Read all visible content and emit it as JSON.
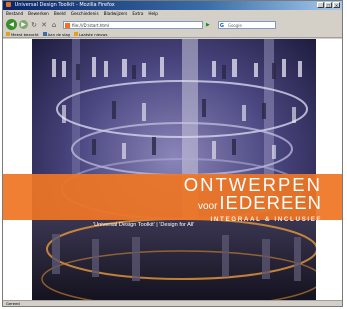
{
  "window": {
    "title": "Universal Design Toolkit - Mozilla Firefox"
  },
  "menu": [
    "Bestand",
    "Bewerken",
    "Beeld",
    "Geschiedenis",
    "Bladwijzers",
    "Extra",
    "Help"
  ],
  "nav": {
    "url": "file:///D:/start.html",
    "search_placeholder": "Google"
  },
  "bookmarks": [
    "Meest bezocht",
    "Aan de slag",
    "Laatste nieuws"
  ],
  "page": {
    "title_line1": "ONTWERPEN",
    "title_voor": "voor",
    "title_line2": "IEDEREEN",
    "subtitle": "INTEGRAAL & INCLUSIEF",
    "caption": "'Universal Design Toolkit'  |  'Design for All'"
  },
  "status": "Gereed",
  "colors": {
    "accent": "#ef7523"
  }
}
